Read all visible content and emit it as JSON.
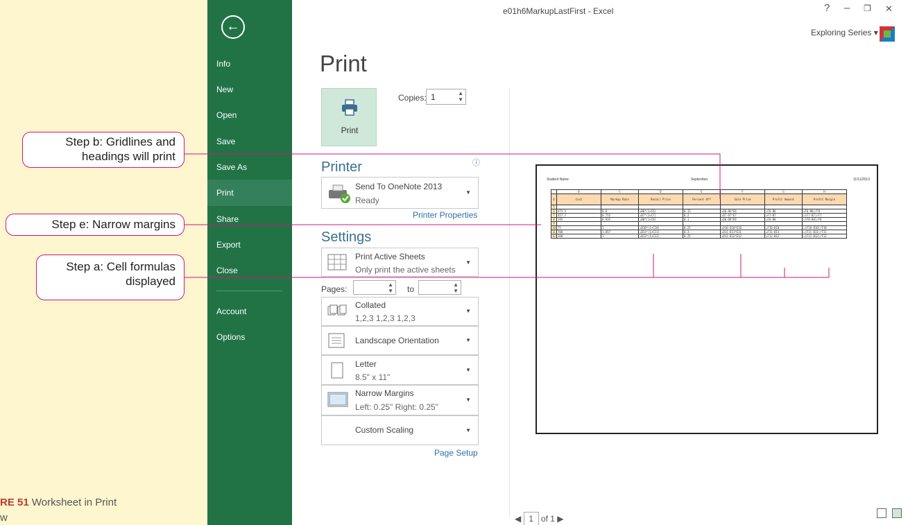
{
  "window": {
    "title": "e01h6MarkupLastFirst - Excel",
    "help": "?",
    "minimize": "–",
    "restore": "❐",
    "close": "✕",
    "account": "Exploring Series ▾"
  },
  "nav": {
    "back_icon": "back-arrow",
    "items": [
      "Info",
      "New",
      "Open",
      "Save",
      "Save As",
      "Print",
      "Share",
      "Export",
      "Close",
      "Account",
      "Options"
    ],
    "active": "Print"
  },
  "print": {
    "heading": "Print",
    "button_label": "Print",
    "copies_label": "Copies:",
    "copies_value": "1"
  },
  "printer": {
    "heading": "Printer",
    "name": "Send To OneNote 2013",
    "status": "Ready",
    "properties_link": "Printer Properties"
  },
  "settings": {
    "heading": "Settings",
    "what": {
      "title": "Print Active Sheets",
      "sub": "Only print the active sheets"
    },
    "pages_label": "Pages:",
    "to_label": "to",
    "collate": {
      "title": "Collated",
      "sub": "1,2,3   1,2,3   1,2,3"
    },
    "orientation": {
      "title": "Landscape Orientation"
    },
    "paper": {
      "title": "Letter",
      "sub": "8.5\" x 11\""
    },
    "margins": {
      "title": "Narrow Margins",
      "sub": "Left:  0.25\"    Right:  0.25\""
    },
    "scaling": {
      "title": "Custom Scaling"
    },
    "page_setup_link": "Page Setup"
  },
  "preview": {
    "header_left": "Student Name",
    "header_center": "September",
    "header_right": "11/11/2013",
    "col_letters": [
      "",
      "B",
      "C",
      "D",
      "E",
      "F",
      "G",
      "H"
    ],
    "headers": [
      "4",
      "Cost",
      "Markup Rate",
      "Retail Price",
      "Percent Off",
      "Sale Price",
      "Profit Amount",
      "Profit Margin"
    ],
    "rows": [
      [
        "5",
        "",
        "",
        "",
        "",
        "",
        "",
        ""
      ],
      [
        "6",
        "475.5",
        "0.6",
        "=B6*(1+C6)",
        "0.15",
        "=D6-D6*E6",
        "=F6-B6",
        "=F6-B6)/F6"
      ],
      [
        "7",
        "457.7",
        "0.755",
        "=B7*(1+C7)",
        "0.2",
        "=D7-D7*E7",
        "=F7-B7",
        "=(F7-B7)/F7"
      ],
      [
        "8",
        "195",
        "0.835",
        "=B8*(1+C8)",
        "0.1",
        "=D8-D8*E8",
        "=F8-B8",
        "=(F8-B8)/F8"
      ],
      [
        "9",
        "",
        "",
        "",
        "",
        "",
        "",
        ""
      ],
      [
        "10",
        "75",
        "1",
        "=B10*(1+C10)",
        "0.25",
        "=D10-D10*E10",
        "=F10-B10",
        "=(F10-B10)/F10"
      ],
      [
        "11",
        "700",
        "1.857",
        "=B11*(1+C11)",
        "0.3",
        "=D11-D11*E11",
        "=F11-B11",
        "=(F11-B11)/F11"
      ],
      [
        "12",
        "200",
        "1",
        "=B12*(1+C12)",
        "0.25",
        "=D12-D12*E12",
        "=F12-B12",
        "=(F12-B12)/F12"
      ]
    ],
    "page_current": "1",
    "page_of": "of 1"
  },
  "callouts": {
    "b": "Step b: Gridlines and headings will print",
    "e": "Step e: Narrow margins",
    "a": "Step a: Cell formulas displayed"
  },
  "caption": {
    "label": "RE 51",
    "text": " Worksheet in Print",
    "line2": "w"
  },
  "colors": {
    "nav_green": "#217346",
    "nav_active": "#33805a",
    "callout_line": "#d0177a",
    "print_button": "#cfe8da"
  }
}
